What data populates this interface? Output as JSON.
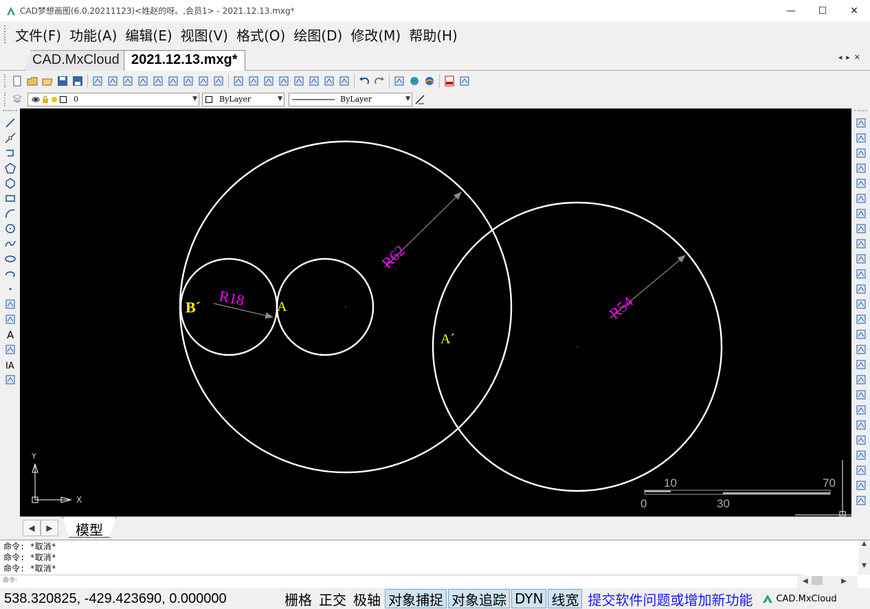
{
  "window": {
    "title": "CAD梦想画图(6.0.20211123)<姓赵的呀。,会员1> - 2021.12.13.mxg*",
    "controls": {
      "minimize": "—",
      "maximize": "☐",
      "close": "✕"
    }
  },
  "menu": [
    {
      "label": "文件(F)"
    },
    {
      "label": "功能(A)"
    },
    {
      "label": "编辑(E)"
    },
    {
      "label": "视图(V)"
    },
    {
      "label": "格式(O)"
    },
    {
      "label": "绘图(D)"
    },
    {
      "label": "修改(M)"
    },
    {
      "label": "帮助(H)"
    }
  ],
  "doc_tabs": [
    {
      "label": "CAD.MxCloud",
      "active": false
    },
    {
      "label": "2021.12.13.mxg*",
      "active": true
    }
  ],
  "tab_arrows": "◂▸✕",
  "toolbar_icons": [
    "new-icon",
    "open-icon",
    "open-folder-icon",
    "save-icon",
    "save-as-icon",
    "zoom-realtime-icon",
    "zoom-window-icon",
    "zoom-in-icon",
    "pan-hand-icon",
    "ucs-icon",
    "zoom-extents-icon",
    "zoom-previous-icon",
    "zoom-all-icon",
    "move-cross-icon",
    "pencil-icon",
    "color-palette-icon",
    "layer-stack-icon",
    "match-prop-icon",
    "image-icon",
    "print-preview-icon",
    "brush-icon",
    "plot-icon",
    "undo-icon",
    "redo-icon",
    "dwg-icon",
    "globe-icon",
    "web-icon",
    "pdf-icon",
    "export-icon"
  ],
  "properties": {
    "layer_value": "0",
    "color_value": "ByLayer",
    "linetype_value": "ByLayer"
  },
  "left_tools": [
    "line-icon",
    "xline-icon",
    "polyline-icon",
    "polygon-icon",
    "pentagon-icon",
    "rectangle-icon",
    "arc-icon",
    "circle-icon",
    "spline-icon",
    "ellipse-icon",
    "ellipse-arc-icon",
    "point-icon",
    "insert-block-icon",
    "make-block-icon",
    "text-icon",
    "hatch-icon",
    "mtext-icon",
    "table-icon"
  ],
  "right_tools": [
    "erase-icon",
    "copy-icon",
    "move-icon",
    "rotate-icon",
    "scale-icon",
    "stretch-icon",
    "array-icon",
    "mirror-icon",
    "fillet-icon",
    "chamfer-icon",
    "break-icon",
    "trim-icon",
    "extend-icon",
    "explode-icon",
    "offset-icon",
    "join-icon",
    "dim-linear-icon",
    "dim-aligned-icon",
    "dim-radius-icon",
    "dim-diameter-icon",
    "dim-angular-icon",
    "dim-continue-icon",
    "draworder-front-icon",
    "draworder-back-icon",
    "draworder-above-icon",
    "draworder-below-icon"
  ],
  "drawing": {
    "labels": {
      "r62": "R62",
      "r54": "R54",
      "r18": "R18",
      "a": "A",
      "b_prime": "B´",
      "a_prime": "A´"
    },
    "ucs": {
      "y": "Y",
      "x": "X"
    },
    "scale_bar": {
      "t10": "10",
      "t70": "70",
      "t0": "0",
      "t30": "30"
    }
  },
  "model_tab": "模型",
  "command_history": [
    "命令:  *取消*",
    "命令:  *取消*",
    "命令:  *取消*"
  ],
  "command_prompt": "命令:",
  "status": {
    "coords": "538.320825,  -429.423690,  0.000000",
    "toggles": [
      {
        "label": "栅格",
        "on": false
      },
      {
        "label": "正交",
        "on": false
      },
      {
        "label": "极轴",
        "on": false
      },
      {
        "label": "对象捕捉",
        "on": true
      },
      {
        "label": "对象追踪",
        "on": true
      },
      {
        "label": "DYN",
        "on": true
      },
      {
        "label": "线宽",
        "on": true
      }
    ],
    "feedback_link": "提交软件问题或增加新功能",
    "brand": "CAD.MxCloud"
  },
  "colors": {
    "canvas_bg": "#000000",
    "circle": "#ffffff",
    "dim_text": "#ff00ff",
    "point_label": "#ffff00",
    "link": "#1a1aff"
  }
}
